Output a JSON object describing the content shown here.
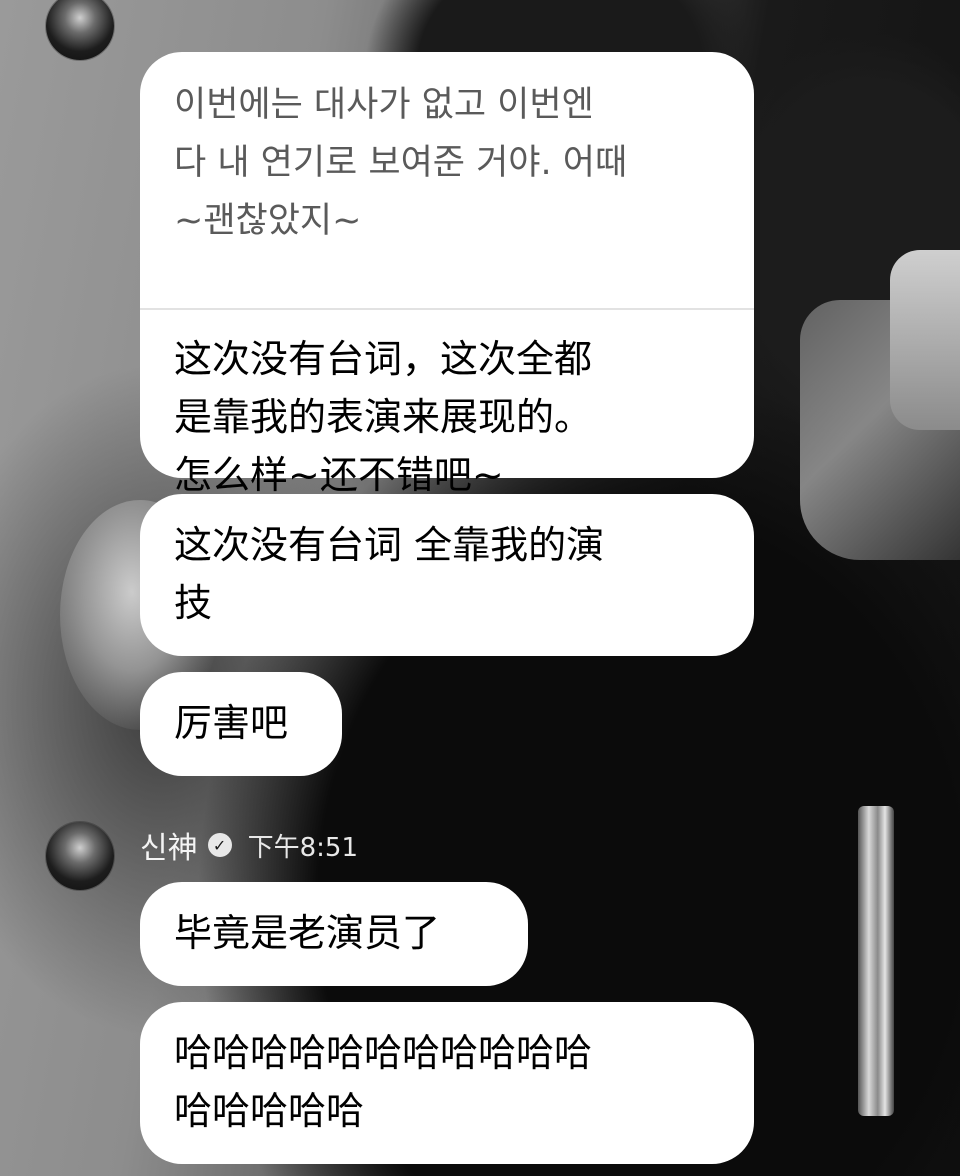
{
  "messages": [
    {
      "original": "이번에는 대사가 없고 이번엔\n다 내 연기로 보여준 거야. 어때\n~괜찮았지~",
      "translation": "这次没有台词，这次全都\n是靠我的表演来展现的。\n怎么样~还不错吧~"
    },
    {
      "text": "这次没有台词 全靠我的演\n技"
    },
    {
      "text": "厉害吧"
    }
  ],
  "sender": {
    "name": "신神",
    "verified_icon": "check-circle-icon",
    "time": "下午8:51"
  },
  "replies": [
    {
      "text": "毕竟是老演员了"
    },
    {
      "text": "哈哈哈哈哈哈哈哈哈哈哈\n哈哈哈哈哈"
    }
  ]
}
